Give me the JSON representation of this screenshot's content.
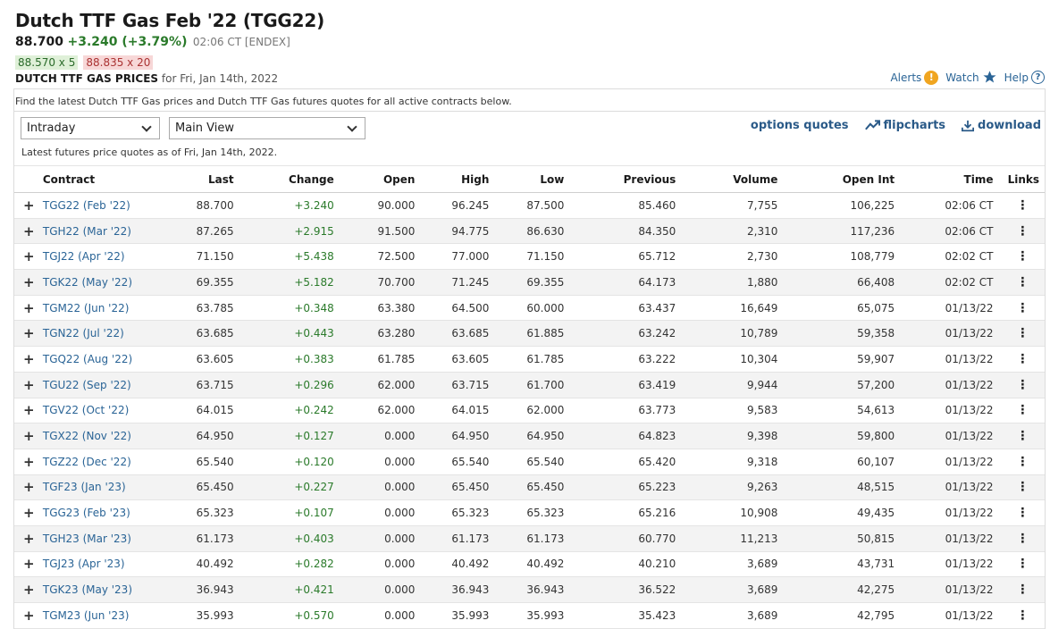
{
  "header": {
    "title": "Dutch TTF Gas Feb '22 (TGG22)",
    "last": "88.700",
    "change": "+3.240 (+3.79%)",
    "time": "02:06 CT [ENDEX]",
    "bid": "88.570 x 5",
    "ask": "88.835 x 20",
    "prices_label": "DUTCH TTF GAS PRICES",
    "prices_date": "for Fri, Jan 14th, 2022"
  },
  "top_links": {
    "alerts": "Alerts",
    "watch": "Watch",
    "help": "Help"
  },
  "description": "Find the latest Dutch TTF Gas prices and Dutch TTF Gas futures quotes for all active contracts below.",
  "controls": {
    "period_select": "Intraday",
    "view_select": "Main View",
    "options_quotes": "options quotes",
    "flipcharts": "flipcharts",
    "download": "download"
  },
  "as_of": "Latest futures price quotes as of Fri, Jan 14th, 2022.",
  "table": {
    "headers": [
      "Contract",
      "Last",
      "Change",
      "Open",
      "High",
      "Low",
      "Previous",
      "Volume",
      "Open Int",
      "Time",
      "Links"
    ],
    "rows": [
      [
        "TGG22 (Feb '22)",
        "88.700",
        "+3.240",
        "90.000",
        "96.245",
        "87.500",
        "85.460",
        "7,755",
        "106,225",
        "02:06 CT"
      ],
      [
        "TGH22 (Mar '22)",
        "87.265",
        "+2.915",
        "91.500",
        "94.775",
        "86.630",
        "84.350",
        "2,310",
        "117,236",
        "02:06 CT"
      ],
      [
        "TGJ22 (Apr '22)",
        "71.150",
        "+5.438",
        "72.500",
        "77.000",
        "71.150",
        "65.712",
        "2,730",
        "108,779",
        "02:02 CT"
      ],
      [
        "TGK22 (May '22)",
        "69.355",
        "+5.182",
        "70.700",
        "71.245",
        "69.355",
        "64.173",
        "1,880",
        "66,408",
        "02:02 CT"
      ],
      [
        "TGM22 (Jun '22)",
        "63.785",
        "+0.348",
        "63.380",
        "64.500",
        "60.000",
        "63.437",
        "16,649",
        "65,075",
        "01/13/22"
      ],
      [
        "TGN22 (Jul '22)",
        "63.685",
        "+0.443",
        "63.280",
        "63.685",
        "61.885",
        "63.242",
        "10,789",
        "59,358",
        "01/13/22"
      ],
      [
        "TGQ22 (Aug '22)",
        "63.605",
        "+0.383",
        "61.785",
        "63.605",
        "61.785",
        "63.222",
        "10,304",
        "59,907",
        "01/13/22"
      ],
      [
        "TGU22 (Sep '22)",
        "63.715",
        "+0.296",
        "62.000",
        "63.715",
        "61.700",
        "63.419",
        "9,944",
        "57,200",
        "01/13/22"
      ],
      [
        "TGV22 (Oct '22)",
        "64.015",
        "+0.242",
        "62.000",
        "64.015",
        "62.000",
        "63.773",
        "9,583",
        "54,613",
        "01/13/22"
      ],
      [
        "TGX22 (Nov '22)",
        "64.950",
        "+0.127",
        "0.000",
        "64.950",
        "64.950",
        "64.823",
        "9,398",
        "59,800",
        "01/13/22"
      ],
      [
        "TGZ22 (Dec '22)",
        "65.540",
        "+0.120",
        "0.000",
        "65.540",
        "65.540",
        "65.420",
        "9,318",
        "60,107",
        "01/13/22"
      ],
      [
        "TGF23 (Jan '23)",
        "65.450",
        "+0.227",
        "0.000",
        "65.450",
        "65.450",
        "65.223",
        "9,263",
        "48,515",
        "01/13/22"
      ],
      [
        "TGG23 (Feb '23)",
        "65.323",
        "+0.107",
        "0.000",
        "65.323",
        "65.323",
        "65.216",
        "10,908",
        "49,435",
        "01/13/22"
      ],
      [
        "TGH23 (Mar '23)",
        "61.173",
        "+0.403",
        "0.000",
        "61.173",
        "61.173",
        "60.770",
        "11,213",
        "50,815",
        "01/13/22"
      ],
      [
        "TGJ23 (Apr '23)",
        "40.492",
        "+0.282",
        "0.000",
        "40.492",
        "40.492",
        "40.210",
        "3,689",
        "43,731",
        "01/13/22"
      ],
      [
        "TGK23 (May '23)",
        "36.943",
        "+0.421",
        "0.000",
        "36.943",
        "36.943",
        "36.522",
        "3,689",
        "42,275",
        "01/13/22"
      ],
      [
        "TGM23 (Jun '23)",
        "35.993",
        "+0.570",
        "0.000",
        "35.993",
        "35.993",
        "35.423",
        "3,689",
        "42,795",
        "01/13/22"
      ]
    ]
  },
  "icons": {
    "expand": "plus-icon",
    "links": "vertical-dots-icon",
    "alerts": "exclamation-icon",
    "watch": "star-icon",
    "help": "question-icon",
    "flipcharts": "trend-chart-icon",
    "download": "download-icon"
  },
  "colors": {
    "positive": "#2a7a2a",
    "link": "#2a6496",
    "bid_bg": "#dff0d8",
    "ask_bg": "#f7d7d7",
    "alert": "#f0a520"
  }
}
